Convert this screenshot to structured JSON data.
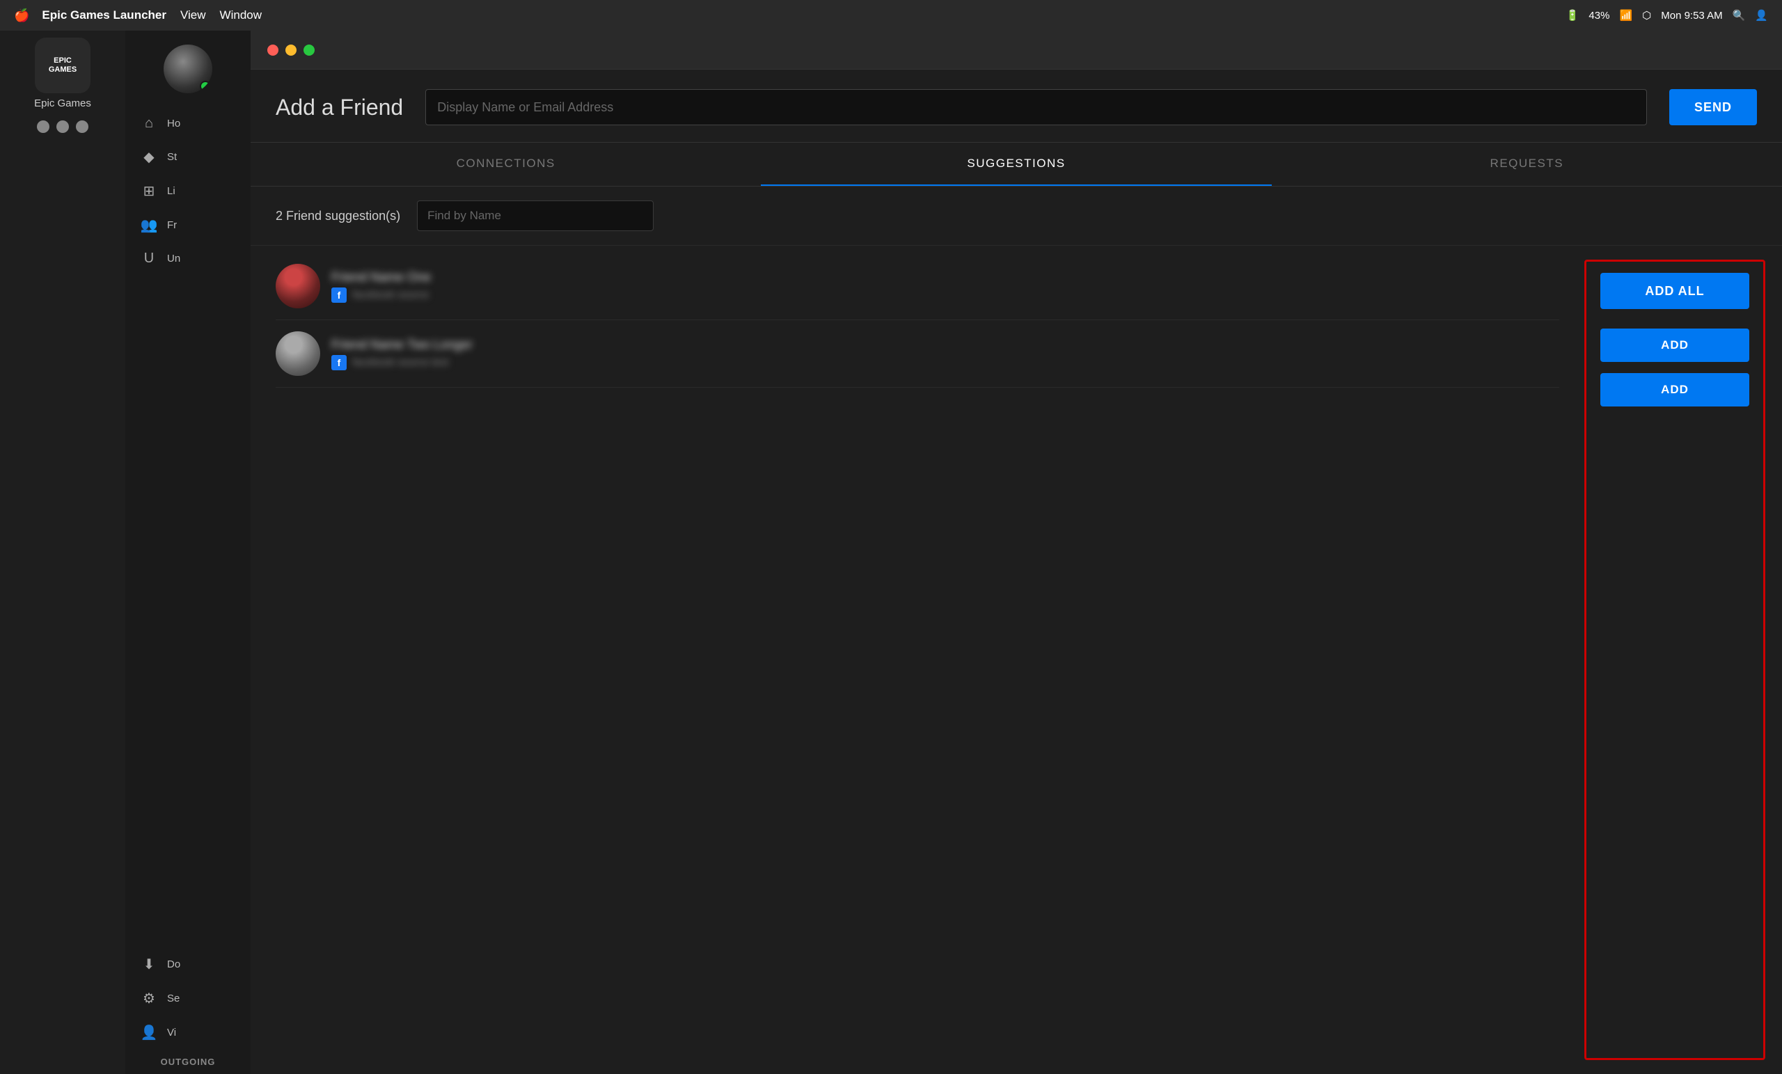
{
  "menubar": {
    "apple": "🍎",
    "app_name": "Epic Games Launcher",
    "menus": [
      "View",
      "Window"
    ],
    "time": "Mon 9:53 AM",
    "battery": "43%"
  },
  "sidebar": {
    "app_name": "Epic Games",
    "logo_lines": [
      "EPIC",
      "GAMES"
    ],
    "nav_items": [
      {
        "label": "Ho",
        "icon": "⌂"
      },
      {
        "label": "St",
        "icon": "◆"
      },
      {
        "label": "Li",
        "icon": "⊞"
      },
      {
        "label": "Fr",
        "icon": "👥"
      },
      {
        "label": "Un",
        "icon": "U"
      },
      {
        "label": "Do",
        "icon": "⬇"
      },
      {
        "label": "Se",
        "icon": "⚙"
      },
      {
        "label": "Vi",
        "icon": "👤"
      }
    ],
    "outgoing_label": "OUTGOING"
  },
  "window": {
    "title": "Add a Friend",
    "email_placeholder": "Display Name or Email Address",
    "send_button": "SEND"
  },
  "tabs": [
    {
      "label": "CONNECTIONS",
      "active": false
    },
    {
      "label": "SUGGESTIONS",
      "active": true
    },
    {
      "label": "REQUESTS",
      "active": false
    }
  ],
  "suggestions": {
    "count_label": "2 Friend suggestion(s)",
    "find_placeholder": "Find by Name",
    "add_all_label": "ADD ALL",
    "friends": [
      {
        "name": "██████ ███",
        "source": "████████ ███",
        "avatar_type": "1"
      },
      {
        "name": "████████████ ██████",
        "source": "███████ ███ ████",
        "avatar_type": "2"
      }
    ],
    "add_buttons": [
      "ADD",
      "ADD"
    ]
  }
}
